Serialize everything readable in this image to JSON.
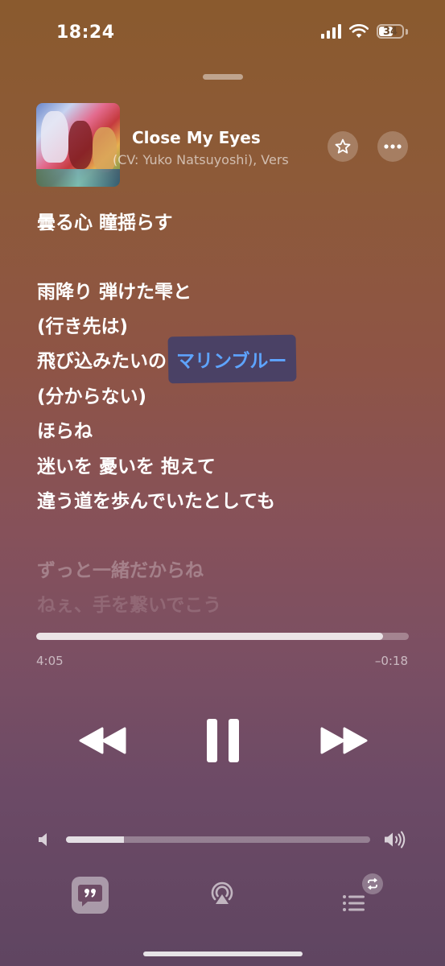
{
  "status": {
    "time": "18:24",
    "battery_level": "34"
  },
  "now_playing": {
    "title": "Close My Eyes",
    "artist_visible": "(CV: Yuko Natsuyoshi), Vers",
    "album_art_icon": "album-art"
  },
  "lyrics": [
    {
      "text": "曇る心 瞳揺らす",
      "state": "past"
    },
    {
      "text": "雨降り 弾けた雫と",
      "state": "current"
    },
    {
      "text": "(行き先は)",
      "state": "current"
    },
    {
      "text": "飛び込みたいの",
      "highlight": "マリンブルー",
      "state": "current"
    },
    {
      "text": "(分からない)",
      "state": "current"
    },
    {
      "text": "ほらね",
      "state": "current"
    },
    {
      "text": "迷いを 憂いを 抱えて",
      "state": "current"
    },
    {
      "text": "違う道を歩んでいたとしても",
      "state": "current"
    },
    {
      "text": "ずっと一緒だからね",
      "state": "upcoming"
    },
    {
      "text": "ねぇ、手を繋いでこう",
      "state": "upcoming"
    }
  ],
  "playback": {
    "elapsed": "4:05",
    "remaining": "–0:18",
    "progress": 0.93
  },
  "volume": {
    "level": 0.19
  },
  "colors": {
    "highlight_text": "#5ea4ff",
    "highlight_bg": "#373c6e"
  },
  "icons": {
    "favorite": "star-icon",
    "more": "ellipsis-icon",
    "rewind": "rewind-icon",
    "pause": "pause-icon",
    "forward": "fast-forward-icon",
    "volume_low": "speaker-low-icon",
    "volume_high": "speaker-high-icon",
    "lyrics": "lyrics-quote-icon",
    "airplay": "airplay-icon",
    "queue": "queue-list-icon",
    "repeat": "repeat-icon"
  }
}
